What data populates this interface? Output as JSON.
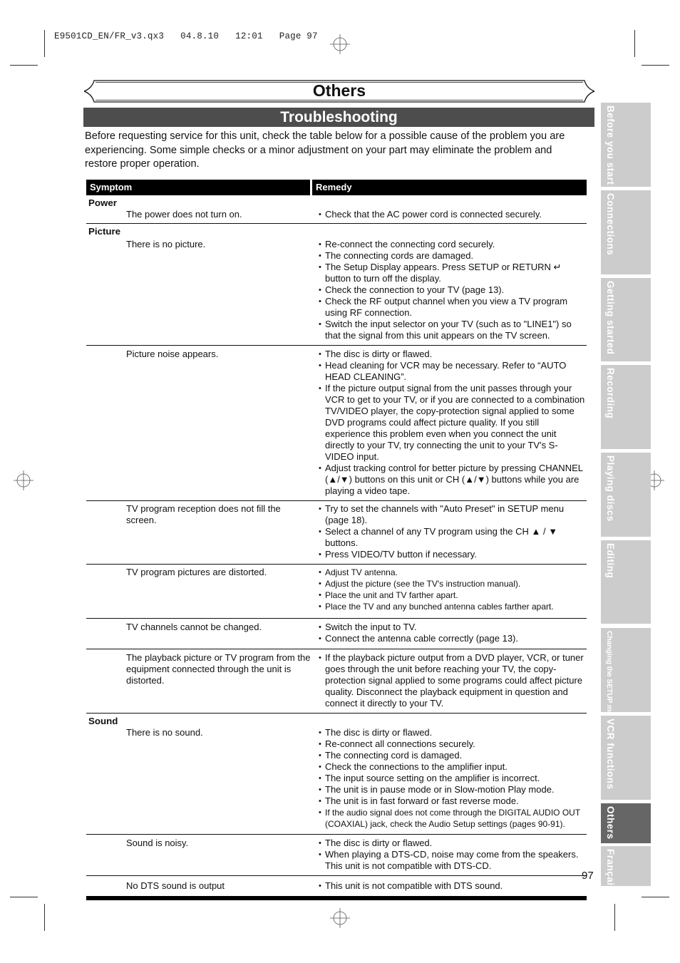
{
  "print_slug": "E9501CD_EN/FR_v3.qx3   04.8.10   12:01   Page 97",
  "section_title": "Others",
  "page_title": "Troubleshooting",
  "intro": "Before requesting service for this unit, check the table below for a possible cause of the problem you are experiencing. Some simple checks or a minor adjustment on your part may eliminate the problem and restore proper operation.",
  "table": {
    "headers": {
      "symptom": "Symptom",
      "remedy": "Remedy"
    },
    "categories": [
      {
        "name": "Power",
        "rows": [
          {
            "symptom": "The power does not turn on.",
            "remedies": [
              "Check that the AC power cord is connected securely."
            ]
          }
        ]
      },
      {
        "name": "Picture",
        "rows": [
          {
            "symptom": "There is no picture.",
            "remedies": [
              "Re-connect the connecting cord securely.",
              "The connecting cords are damaged.",
              "The Setup Display appears. Press SETUP or RETURN ↵ button to turn off the display.",
              "Check the connection to your TV (page 13).",
              "Check the RF output channel when you view a TV program using RF connection.",
              "Switch the input selector on your TV (such as to \"LINE1\") so that the signal from this unit appears on the TV screen."
            ]
          },
          {
            "symptom": "Picture noise appears.",
            "remedies": [
              "The disc is dirty or flawed.",
              "Head cleaning for VCR may be necessary. Refer to “AUTO HEAD CLEANING”.",
              "If the picture output signal from the unit passes through your VCR to get to your TV, or if you are connected to a combination TV/VIDEO player, the copy-protection signal applied to some DVD programs could affect picture quality. If you still experience this problem even when you connect the unit directly to your TV, try connecting the unit to your TV's S-VIDEO input.",
              "Adjust tracking control for better picture by pressing CHANNEL (▲/▼) buttons on this unit or CH (▲/▼) buttons while you are playing a video tape."
            ]
          },
          {
            "symptom": "TV program reception does not fill the screen.",
            "remedies": [
              "Try to set the channels with \"Auto Preset\" in SETUP menu (page 18).",
              "Select a channel of any TV program using the CH ▲ / ▼ buttons.",
              "Press VIDEO/TV button if necessary."
            ]
          },
          {
            "symptom": "TV program pictures are distorted.",
            "remedies": [
              "Adjust TV antenna.",
              "Adjust the picture (see the TV's instruction manual).",
              "Place the unit and TV farther apart.",
              "Place the TV and any bunched antenna cables farther apart."
            ]
          },
          {
            "symptom": "TV channels cannot be changed.",
            "remedies": [
              "Switch the input to TV.",
              "Connect the antenna cable correctly (page 13)."
            ]
          },
          {
            "symptom": "The playback picture or TV program from the equipment connected through the unit is distorted.",
            "remedies": [
              "If the playback picture output from a DVD player, VCR, or tuner goes through the unit before reaching your TV, the copy-protection signal applied to some programs could affect picture quality. Disconnect the playback equipment in question and connect it directly to your TV."
            ]
          }
        ]
      },
      {
        "name": "Sound",
        "rows": [
          {
            "symptom": "There is no sound.",
            "remedies": [
              "The disc is dirty or flawed.",
              "Re-connect all connections securely.",
              "The connecting cord is damaged.",
              "Check the connections to the amplifier input.",
              "The input source setting on the amplifier is incorrect.",
              "The unit is in pause mode or in Slow-motion Play mode.",
              "The unit is in fast forward or fast reverse mode.",
              "If the audio signal does not come through the DIGITAL AUDIO OUT (COAXIAL) jack, check the Audio Setup settings (pages 90-91)."
            ]
          },
          {
            "symptom": "Sound is noisy.",
            "remedies": [
              "The disc is dirty or flawed.",
              "When playing a DTS-CD, noise may come from the speakers. This unit is not compatible with DTS-CD."
            ]
          },
          {
            "symptom": "No DTS sound is output",
            "remedies": [
              "This unit is not compatible with DTS sound."
            ]
          }
        ]
      }
    ]
  },
  "page_number": "97",
  "side_tabs": [
    {
      "label": "Before you start",
      "active": false
    },
    {
      "label": "Connections",
      "active": false
    },
    {
      "label": "Getting started",
      "active": false
    },
    {
      "label": "Recording",
      "active": false
    },
    {
      "label": "Playing discs",
      "active": false
    },
    {
      "label": "Editing",
      "active": false
    },
    {
      "label": "Changing the SETUP menu",
      "active": false
    },
    {
      "label": "VCR functions",
      "active": false
    },
    {
      "label": "Others",
      "active": true
    },
    {
      "label": "Français",
      "active": false
    }
  ],
  "colors": {
    "banner": "#4d4d4d",
    "tab_inactive": "#cccccc",
    "tab_active": "#666666",
    "header_bg": "#000000"
  }
}
